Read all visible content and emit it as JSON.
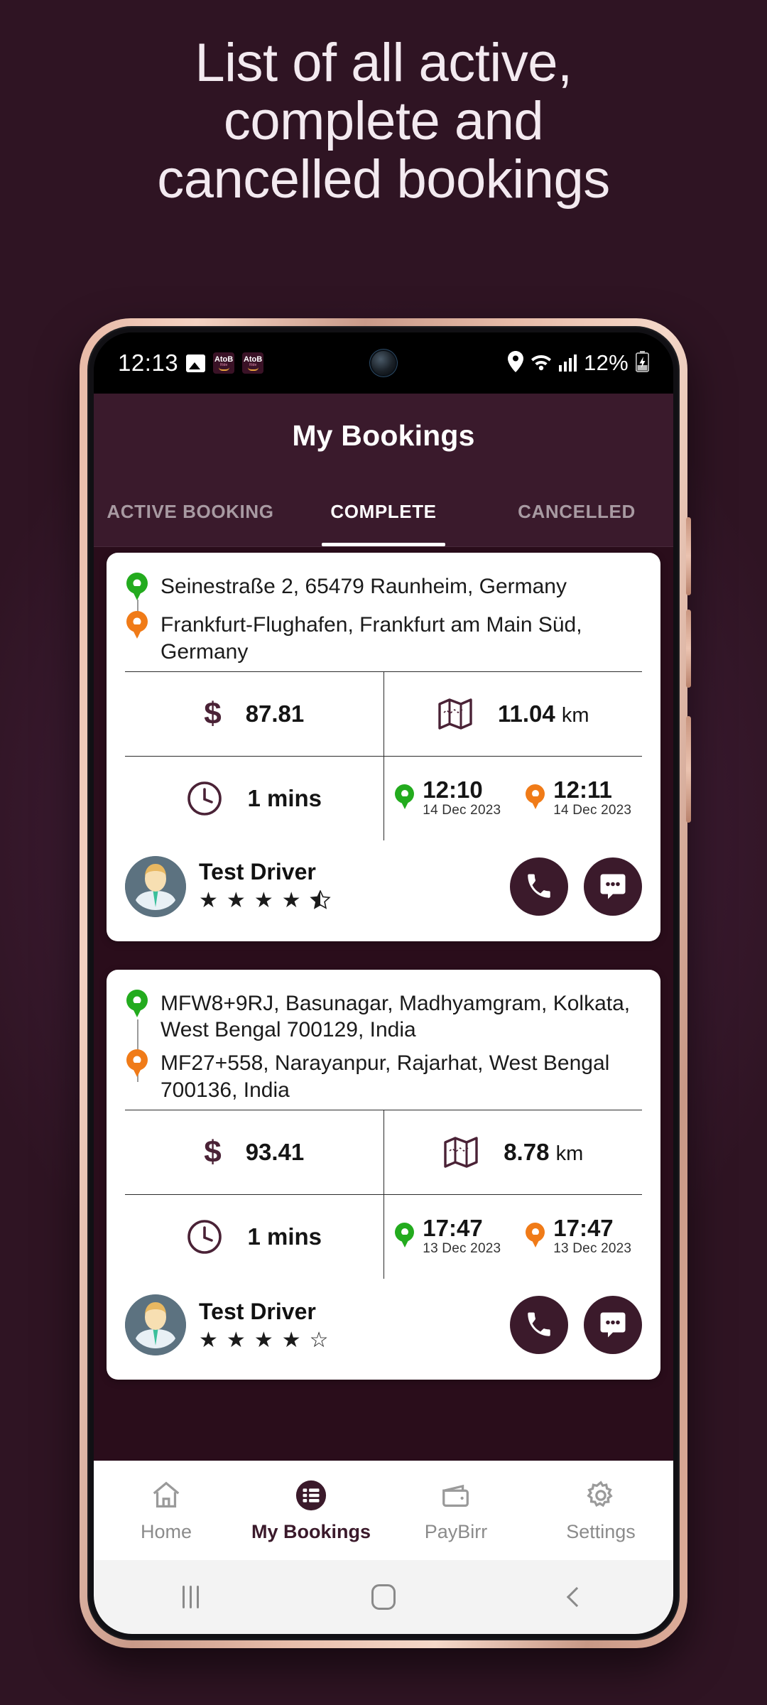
{
  "headline": {
    "line1": "List of all active,",
    "line2": "complete and",
    "line3": "cancelled bookings"
  },
  "status_bar": {
    "clock": "12:13",
    "icons": [
      "gallery-icon",
      "atob-app-icon",
      "atob-app-icon"
    ],
    "app_badge_label": "AtoB",
    "battery_percent": "12%",
    "right_icons": [
      "location-icon",
      "wifi-icon",
      "signal-icon",
      "battery-icon"
    ]
  },
  "app_header": {
    "title": "My Bookings"
  },
  "tabs": [
    {
      "label": "ACTIVE BOOKING",
      "active": false
    },
    {
      "label": "COMPLETE",
      "active": true
    },
    {
      "label": "CANCELLED",
      "active": false
    }
  ],
  "bookings": [
    {
      "pickup": "Seinestraße 2, 65479 Raunheim, Germany",
      "dropoff": "Frankfurt-Flughafen, Frankfurt am Main Süd, Germany",
      "fare": "87.81",
      "distance": "11.04",
      "distance_unit": "km",
      "duration": "1 mins",
      "pickup_time": "12:10",
      "pickup_date": "14 Dec 2023",
      "dropoff_time": "12:11",
      "dropoff_date": "14 Dec 2023",
      "driver_name": "Test Driver",
      "rating": 4.5
    },
    {
      "pickup": "MFW8+9RJ, Basunagar, Madhyamgram, Kolkata, West Bengal 700129, India",
      "dropoff": "MF27+558, Narayanpur, Rajarhat, West Bengal 700136, India",
      "fare": "93.41",
      "distance": "8.78",
      "distance_unit": "km",
      "duration": "1 mins",
      "pickup_time": "17:47",
      "pickup_date": "13 Dec 2023",
      "dropoff_time": "17:47",
      "dropoff_date": "13 Dec 2023",
      "driver_name": "Test Driver",
      "rating": 4.0
    }
  ],
  "bottom_nav": [
    {
      "label": "Home",
      "icon": "home-icon",
      "active": false
    },
    {
      "label": "My Bookings",
      "icon": "list-icon",
      "active": true
    },
    {
      "label": "PayBirr",
      "icon": "wallet-icon",
      "active": false
    },
    {
      "label": "Settings",
      "icon": "gear-icon",
      "active": false
    }
  ],
  "android_nav": [
    "recents-button",
    "home-button",
    "back-button"
  ],
  "colors": {
    "background": "#2F1423",
    "brand_plum": "#3A1A2C",
    "pickup_green": "#23AB1E",
    "dropoff_orange": "#F07B18",
    "card_white": "#FFFFFF"
  }
}
